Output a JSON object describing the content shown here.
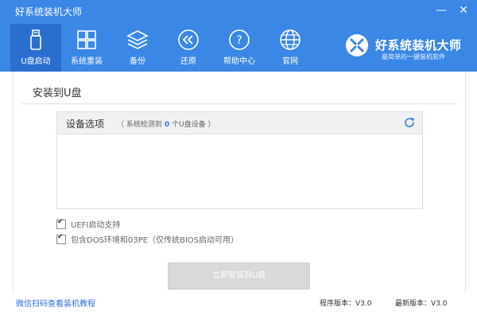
{
  "window": {
    "title": "好系统装机大师",
    "minimize": "—",
    "close": "✕"
  },
  "nav": [
    {
      "label": "U盘启动",
      "icon": "usb-icon"
    },
    {
      "label": "系统重装",
      "icon": "windows-icon"
    },
    {
      "label": "备份",
      "icon": "layers-icon"
    },
    {
      "label": "还原",
      "icon": "restore-icon"
    },
    {
      "label": "帮助中心",
      "icon": "help-icon"
    },
    {
      "label": "官网",
      "icon": "globe-icon"
    }
  ],
  "brand": {
    "name": "好系统装机大师",
    "subtitle": "最简单的一键装机软件"
  },
  "page": {
    "title": "安装到U盘"
  },
  "device_options": {
    "title": "设备选项",
    "hint_prefix": "（ 系统检测到",
    "count": "0",
    "hint_suffix": "个U盘设备 ）"
  },
  "options": [
    {
      "label": "UEFI启动支持",
      "checked": true
    },
    {
      "label": "包含DOS环境和03PE（仅传统BIOS启动可用）",
      "checked": true
    }
  ],
  "install_button": "立即安装到U盘",
  "footer": {
    "tutorial_link": "微信扫码查看装机教程",
    "program_version": "程序版本：V3.0",
    "latest_version": "最新版本：V3.0"
  },
  "colors": {
    "accent": "#3a87e6",
    "active_nav": "#2a6fd0",
    "link": "#2b6fd3"
  }
}
